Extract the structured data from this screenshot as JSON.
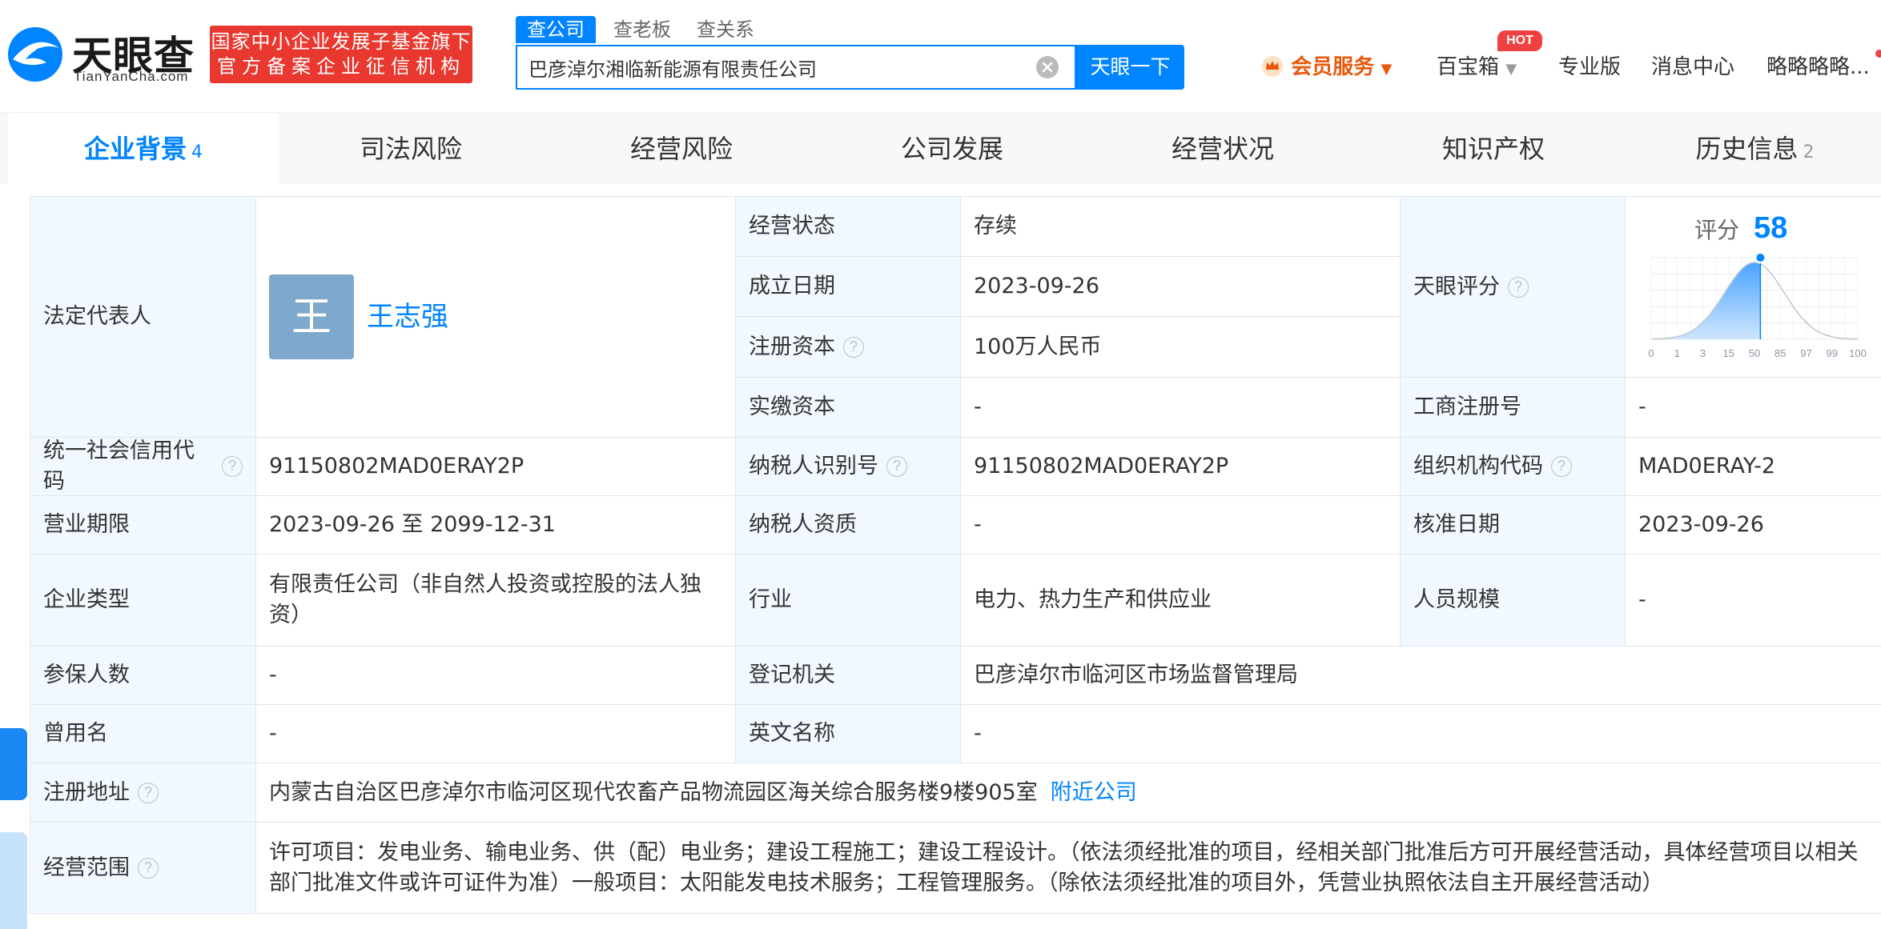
{
  "header": {
    "logo_cn": "天眼查",
    "logo_en": "TianYanCha.com",
    "badge_line1": "国家中小企业发展子基金旗下",
    "badge_line2": "官方备案企业征信机构",
    "search_tabs": [
      "查公司",
      "查老板",
      "查关系"
    ],
    "search_value": "巴彦淖尔湘临新能源有限责任公司",
    "search_button": "天眼一下",
    "vip": "会员服务",
    "baobao": "百宝箱",
    "hot": "HOT",
    "pro": "专业版",
    "messages": "消息中心",
    "user": "略略略略..."
  },
  "tabs": [
    {
      "label": "企业背景",
      "count": "4"
    },
    {
      "label": "司法风险",
      "count": ""
    },
    {
      "label": "经营风险",
      "count": ""
    },
    {
      "label": "公司发展",
      "count": ""
    },
    {
      "label": "经营状况",
      "count": ""
    },
    {
      "label": "知识产权",
      "count": ""
    },
    {
      "label": "历史信息",
      "count": "2"
    }
  ],
  "info": {
    "legal_rep_label": "法定代表人",
    "legal_rep_avatar": "王",
    "legal_rep_name": "王志强",
    "status_label": "经营状态",
    "status": "存续",
    "founded_label": "成立日期",
    "founded": "2023-09-26",
    "reg_capital_label": "注册资本",
    "reg_capital": "100万人民币",
    "paid_capital_label": "实缴资本",
    "paid_capital": "-",
    "score_label": "天眼评分",
    "score_title": "评分",
    "score": "58",
    "biz_reg_no_label": "工商注册号",
    "biz_reg_no": "-",
    "credit_code_label": "统一社会信用代码",
    "credit_code": "91150802MAD0ERAY2P",
    "taxpayer_id_label": "纳税人识别号",
    "taxpayer_id": "91150802MAD0ERAY2P",
    "org_code_label": "组织机构代码",
    "org_code": "MAD0ERAY-2",
    "term_label": "营业期限",
    "term": "2023-09-26 至 2099-12-31",
    "taxpayer_qual_label": "纳税人资质",
    "taxpayer_qual": "-",
    "approval_date_label": "核准日期",
    "approval_date": "2023-09-26",
    "type_label": "企业类型",
    "type": "有限责任公司（非自然人投资或控股的法人独资）",
    "industry_label": "行业",
    "industry": "电力、热力生产和供应业",
    "staff_label": "人员规模",
    "staff": "-",
    "insured_label": "参保人数",
    "insured": "-",
    "authority_label": "登记机关",
    "authority": "巴彦淖尔市临河区市场监督管理局",
    "former_name_label": "曾用名",
    "former_name": "-",
    "english_name_label": "英文名称",
    "english_name": "-",
    "address_label": "注册地址",
    "address": "内蒙古自治区巴彦淖尔市临河区现代农畜产品物流园区海关综合服务楼9楼905室",
    "nearby_link": "附近公司",
    "scope_label": "经营范围",
    "scope": "许可项目：发电业务、输电业务、供（配）电业务；建设工程施工；建设工程设计。（依法须经批准的项目，经相关部门批准后方可开展经营活动，具体经营项目以相关部门批准文件或许可证件为准）一般项目：太阳能发电技术服务；工程管理服务。（除依法须经批准的项目外，凭营业执照依法自主开展经营活动）"
  },
  "chart_data": {
    "type": "area",
    "x_tick_labels": [
      "0",
      "1",
      "3",
      "15",
      "50",
      "85",
      "97",
      "99",
      "100"
    ],
    "marker_value": 58,
    "grid": true
  },
  "colors": {
    "accent": "#0084ff",
    "badge": "#e8382f",
    "vip": "#e8590c",
    "label_bg": "#f2f8ff"
  }
}
